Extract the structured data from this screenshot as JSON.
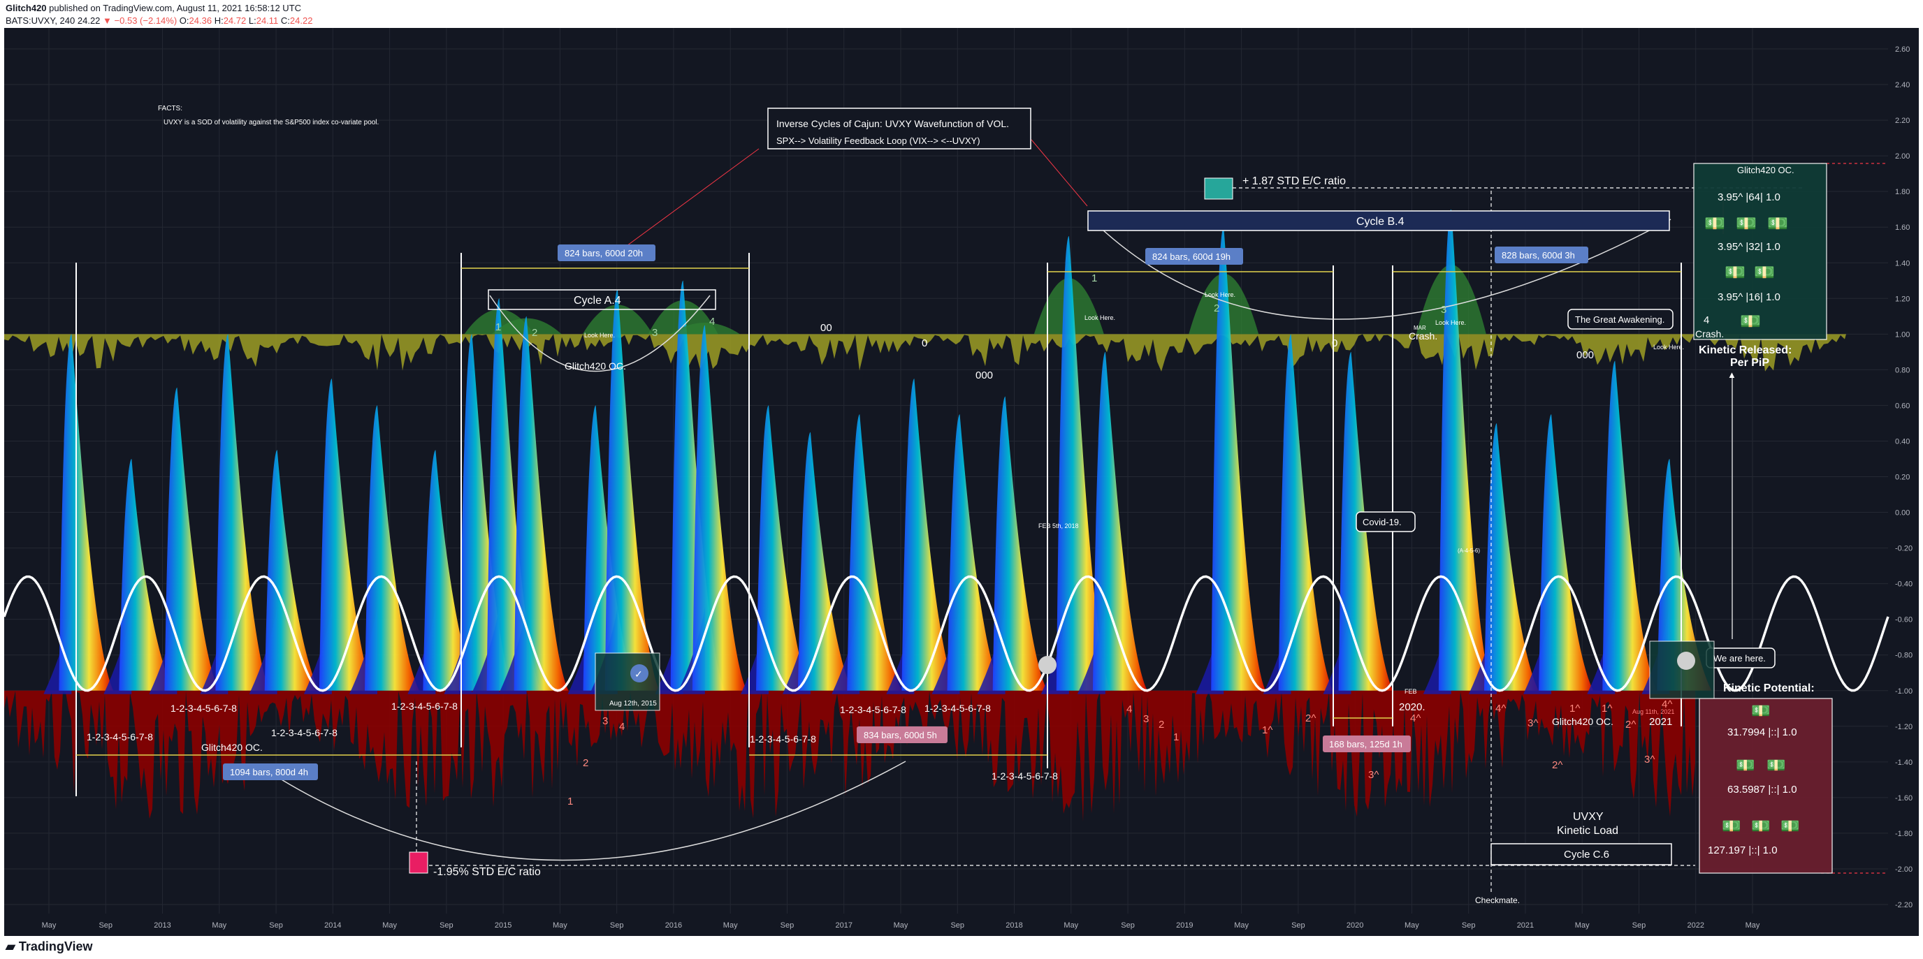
{
  "header": {
    "publisher": "Glitch420",
    "published_text": "published on TradingView.com, August 11, 2021 16:58:12 UTC",
    "symbol": "BATS:UVXY, 240",
    "last": "24.22",
    "change": "−0.53 (−2.14%)",
    "o_label": "O:",
    "o": "24.36",
    "h_label": "H:",
    "h": "24.72",
    "l_label": "L:",
    "l": "24.11",
    "c_label": "C:",
    "c": "24.22"
  },
  "watermark": "TradingView",
  "colors": {
    "background": "#131722",
    "grid": "#242833",
    "wave": "#ffffff",
    "positive_fill": "#2e7d32",
    "mid_fill": "#9e9d24",
    "negative_fill": "#8b0000",
    "blue_fill": "#1a1aa6",
    "label_blue": "#5b7fc7"
  },
  "chart_data": {
    "type": "area",
    "y_axis": {
      "min": -2.2,
      "max": 2.6,
      "ticks": [
        "2.60",
        "2.40",
        "2.20",
        "2.00",
        "1.80",
        "1.60",
        "1.40",
        "1.20",
        "1.00",
        "0.80",
        "0.60",
        "0.40",
        "0.20",
        "0.00",
        "-0.20",
        "-0.40",
        "-0.60",
        "-0.80",
        "-1.00",
        "-1.20",
        "-1.40",
        "-1.60",
        "-1.80",
        "-2.00",
        "-2.20"
      ]
    },
    "x_axis": {
      "ticks": [
        "May",
        "Sep",
        "2013",
        "May",
        "Sep",
        "2014",
        "May",
        "Sep",
        "2015",
        "May",
        "Sep",
        "2016",
        "May",
        "Sep",
        "2017",
        "May",
        "Sep",
        "2018",
        "May",
        "Sep",
        "2019",
        "May",
        "Sep",
        "2020",
        "May",
        "Sep",
        "2021",
        "May",
        "Sep",
        "2022",
        "May"
      ]
    },
    "wave": {
      "amplitude": 0.32,
      "baseline": -0.68,
      "cycles": 16
    },
    "spikes": [
      {
        "x": 2012.62,
        "peak": 1.0
      },
      {
        "x": 2012.95,
        "peak": 0.3
      },
      {
        "x": 2013.2,
        "peak": 0.7
      },
      {
        "x": 2013.48,
        "peak": 1.0
      },
      {
        "x": 2013.75,
        "peak": 0.35
      },
      {
        "x": 2014.05,
        "peak": 0.75
      },
      {
        "x": 2014.3,
        "peak": 0.6
      },
      {
        "x": 2014.62,
        "peak": 0.35
      },
      {
        "x": 2014.82,
        "peak": 1.0
      },
      {
        "x": 2014.97,
        "peak": 1.2
      },
      {
        "x": 2015.12,
        "peak": 1.1
      },
      {
        "x": 2015.5,
        "peak": 0.6
      },
      {
        "x": 2015.62,
        "peak": 1.25
      },
      {
        "x": 2015.98,
        "peak": 1.3
      },
      {
        "x": 2016.1,
        "peak": 1.05
      },
      {
        "x": 2016.45,
        "peak": 0.6
      },
      {
        "x": 2016.68,
        "peak": 0.45
      },
      {
        "x": 2016.95,
        "peak": 0.55
      },
      {
        "x": 2017.25,
        "peak": 0.75
      },
      {
        "x": 2017.5,
        "peak": 0.55
      },
      {
        "x": 2017.75,
        "peak": 0.65
      },
      {
        "x": 2018.1,
        "peak": 1.55
      },
      {
        "x": 2018.3,
        "peak": 0.9
      },
      {
        "x": 2018.95,
        "peak": 1.6
      },
      {
        "x": 2019.32,
        "peak": 1.0
      },
      {
        "x": 2019.65,
        "peak": 0.9
      },
      {
        "x": 2020.2,
        "peak": 1.7
      },
      {
        "x": 2020.45,
        "peak": 0.5
      },
      {
        "x": 2020.75,
        "peak": 0.55
      },
      {
        "x": 2021.1,
        "peak": 0.85
      },
      {
        "x": 2021.4,
        "peak": 0.3
      }
    ]
  },
  "price_axis_labels": [
    "2.60",
    "2.40",
    "2.20",
    "2.00",
    "1.80",
    "1.60",
    "1.40",
    "1.20",
    "1.00",
    "0.80",
    "0.60",
    "0.40",
    "0.20",
    "0.00",
    "-0.20",
    "-0.40",
    "-0.60",
    "-0.80",
    "-1.00",
    "-1.20",
    "-1.40",
    "-1.60",
    "-1.80",
    "-2.00",
    "-2.20"
  ],
  "time_axis_labels": [
    "May",
    "Sep",
    "2013",
    "May",
    "Sep",
    "2014",
    "May",
    "Sep",
    "2015",
    "May",
    "Sep",
    "2016",
    "May",
    "Sep",
    "2017",
    "May",
    "Sep",
    "2018",
    "May",
    "Sep",
    "2019",
    "May",
    "Sep",
    "2020",
    "May",
    "Sep",
    "2021",
    "May",
    "Sep",
    "2022",
    "May"
  ],
  "notes": {
    "facts_title": "FACTS:",
    "facts_line": "UVXY is a SOD of volatility against the S&P500 index co-variate pool."
  },
  "title_box": {
    "line1": "Inverse Cycles of Cajun: UVXY Wavefunction of VOL.",
    "line2": "SPX--> Volatility Feedback Loop (VIX--> <--UVXY)"
  },
  "cycles": {
    "a": "Cycle A.4",
    "b": "Cycle B.4",
    "c": "Cycle C.6"
  },
  "bar_labels": {
    "b1": "824 bars, 600d 20h",
    "b2": "824 bars, 600d 19h",
    "b3": "828 bars, 600d 3h",
    "b4": "1094 bars, 800d 4h",
    "b5": "834 bars, 600d 5h",
    "b6": "168 bars, 125d 1h"
  },
  "std": {
    "plus": "+ 1.87 STD E/C ratio",
    "minus": "-1.95% STD E/C ratio"
  },
  "annotations": {
    "glitch": "Glitch420 OC.",
    "look_here": "Look Here.",
    "crash": "Crash.",
    "mar": "MAR",
    "the_great_awakening": "The Great Awakening.",
    "covid": "Covid-19.",
    "we_are_here": "We are here.",
    "feb_2018": "FEB 5th, 2018",
    "aug_2015": "Aug 12th, 2015",
    "aug_2021": "Aug 11th, 2021",
    "year_2020": "2020.",
    "year_2021": "2021",
    "feb": "FEB",
    "checkmate": "Checkmate.",
    "uvxy": "UVXY",
    "kinetic_load": "Kinetic Load",
    "sequence": "1-2-3-4-5-6-7-8",
    "zero": "0",
    "double_zero": "00",
    "triple_zero": "000",
    "small_seq": "(A-4-5-6)"
  },
  "kinetic_released": {
    "title": "Glitch420 OC.",
    "row1": "3.95^ |64| 1.0",
    "row2": "3.95^ |32| 1.0",
    "row3": "3.95^ |16| 1.0",
    "footer1": "Kinetic Released:",
    "footer2": "Per PiP"
  },
  "kinetic_potential": {
    "title": "Kinetic Potential:",
    "row1": "31.7994 |::| 1.0",
    "row2": "63.5987 |::| 1.0",
    "row3": "127.197 |::| 1.0"
  },
  "wave_numbers": {
    "n1": "1",
    "n2": "2",
    "n3": "3",
    "n4": "4",
    "c1": "1^",
    "c2": "2^",
    "c3": "3^",
    "c4": "4^"
  }
}
